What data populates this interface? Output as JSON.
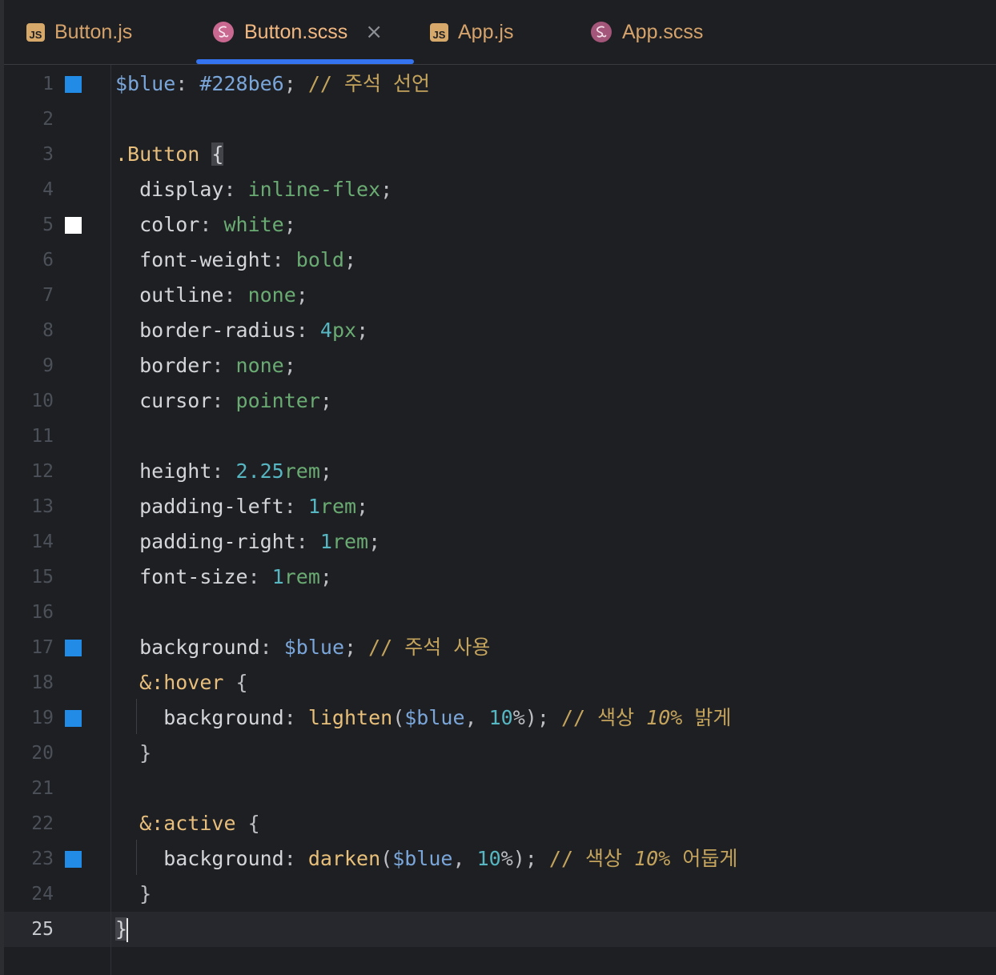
{
  "tabs": [
    {
      "label": "Button.js",
      "icon": "js-icon",
      "active": false
    },
    {
      "label": "Button.scss",
      "icon": "sass-icon",
      "active": true,
      "closable": true
    },
    {
      "label": "App.js",
      "icon": "js-icon",
      "active": false
    },
    {
      "label": "App.scss",
      "icon": "sass-icon",
      "active": false
    }
  ],
  "close_glyph": "×",
  "js_badge": "JS",
  "current_line": 25,
  "colors": {
    "background": "#1e1f22",
    "accent": "#3574f0",
    "swatch_blue": "#228be6",
    "swatch_white": "#ffffff"
  },
  "lines": [
    {
      "n": "1",
      "swatch": "#228be6",
      "tokens": [
        [
          "t-var",
          "$blue"
        ],
        [
          "",
          "-: "
        ],
        [
          "t-var",
          "#228be6"
        ],
        [
          "",
          "; "
        ],
        [
          "t-com",
          "// 주석 선언"
        ]
      ]
    },
    {
      "n": "2",
      "tokens": []
    },
    {
      "n": "3",
      "tokens": [
        [
          "t-sel",
          ".Button"
        ],
        [
          "",
          " "
        ],
        [
          "t-brace-hl",
          "{"
        ]
      ]
    },
    {
      "n": "4",
      "tokens": [
        [
          "t-prop",
          "  display"
        ],
        [
          "",
          ": "
        ],
        [
          "t-kw",
          "inline-flex"
        ],
        [
          "",
          ";"
        ]
      ]
    },
    {
      "n": "5",
      "swatch": "#ffffff",
      "tokens": [
        [
          "t-prop",
          "  color"
        ],
        [
          "",
          ": "
        ],
        [
          "t-kw",
          "white"
        ],
        [
          "",
          ";"
        ]
      ]
    },
    {
      "n": "6",
      "tokens": [
        [
          "t-prop",
          "  font-weight"
        ],
        [
          "",
          ": "
        ],
        [
          "t-kw",
          "bold"
        ],
        [
          "",
          ";"
        ]
      ]
    },
    {
      "n": "7",
      "tokens": [
        [
          "t-prop",
          "  outline"
        ],
        [
          "",
          ": "
        ],
        [
          "t-kw",
          "none"
        ],
        [
          "",
          ";"
        ]
      ]
    },
    {
      "n": "8",
      "tokens": [
        [
          "t-prop",
          "  border-radius"
        ],
        [
          "",
          ": "
        ],
        [
          "t-num",
          "4"
        ],
        [
          "t-kw",
          "px"
        ],
        [
          "",
          ";"
        ]
      ]
    },
    {
      "n": "9",
      "tokens": [
        [
          "t-prop",
          "  border"
        ],
        [
          "",
          ": "
        ],
        [
          "t-kw",
          "none"
        ],
        [
          "",
          ";"
        ]
      ]
    },
    {
      "n": "10",
      "tokens": [
        [
          "t-prop",
          "  cursor"
        ],
        [
          "",
          ": "
        ],
        [
          "t-kw",
          "pointer"
        ],
        [
          "",
          ";"
        ]
      ]
    },
    {
      "n": "11",
      "tokens": []
    },
    {
      "n": "12",
      "tokens": [
        [
          "t-prop",
          "  height"
        ],
        [
          "",
          ": "
        ],
        [
          "t-num",
          "2.25"
        ],
        [
          "t-kw",
          "rem"
        ],
        [
          "",
          ";"
        ]
      ]
    },
    {
      "n": "13",
      "tokens": [
        [
          "t-prop",
          "  padding-left"
        ],
        [
          "",
          ": "
        ],
        [
          "t-num",
          "1"
        ],
        [
          "t-kw",
          "rem"
        ],
        [
          "",
          ";"
        ]
      ]
    },
    {
      "n": "14",
      "tokens": [
        [
          "t-prop",
          "  padding-right"
        ],
        [
          "",
          ": "
        ],
        [
          "t-num",
          "1"
        ],
        [
          "t-kw",
          "rem"
        ],
        [
          "",
          ";"
        ]
      ]
    },
    {
      "n": "15",
      "tokens": [
        [
          "t-prop",
          "  font-size"
        ],
        [
          "",
          ": "
        ],
        [
          "t-num",
          "1"
        ],
        [
          "t-kw",
          "rem"
        ],
        [
          "",
          ";"
        ]
      ]
    },
    {
      "n": "16",
      "tokens": []
    },
    {
      "n": "17",
      "swatch": "#228be6",
      "tokens": [
        [
          "t-prop",
          "  background"
        ],
        [
          "",
          ": "
        ],
        [
          "t-var",
          "$blue"
        ],
        [
          "",
          "; "
        ],
        [
          "t-com",
          "// 주석 사용"
        ]
      ]
    },
    {
      "n": "18",
      "tokens": [
        [
          "t-sel",
          "  &:hover"
        ],
        [
          "",
          " {"
        ]
      ]
    },
    {
      "n": "19",
      "swatch": "#228be6",
      "tokens": [
        [
          "t-prop",
          "    background"
        ],
        [
          "",
          ": "
        ],
        [
          "t-fn",
          "lighten"
        ],
        [
          "",
          "("
        ],
        [
          "t-var",
          "$blue"
        ],
        [
          "",
          ", "
        ],
        [
          "t-num",
          "10"
        ],
        [
          "",
          "%); "
        ],
        [
          "t-com",
          "// 색상 "
        ],
        [
          "t-com t-it",
          "10%"
        ],
        [
          "t-com",
          " 밝게"
        ]
      ]
    },
    {
      "n": "20",
      "tokens": [
        [
          "",
          "  }"
        ]
      ]
    },
    {
      "n": "21",
      "tokens": []
    },
    {
      "n": "22",
      "tokens": [
        [
          "t-sel",
          "  &:active"
        ],
        [
          "",
          " {"
        ]
      ]
    },
    {
      "n": "23",
      "swatch": "#228be6",
      "tokens": [
        [
          "t-prop",
          "    background"
        ],
        [
          "",
          ": "
        ],
        [
          "t-fn",
          "darken"
        ],
        [
          "",
          "("
        ],
        [
          "t-var",
          "$blue"
        ],
        [
          "",
          ", "
        ],
        [
          "t-num",
          "10"
        ],
        [
          "",
          "%); "
        ],
        [
          "t-com",
          "// 색상 "
        ],
        [
          "t-com t-it",
          "10%"
        ],
        [
          "t-com",
          " 어둡게"
        ]
      ]
    },
    {
      "n": "24",
      "tokens": [
        [
          "",
          "  }"
        ]
      ]
    },
    {
      "n": "25",
      "tokens": [
        [
          "t-brace-hl",
          "}"
        ]
      ],
      "caret": true
    }
  ]
}
